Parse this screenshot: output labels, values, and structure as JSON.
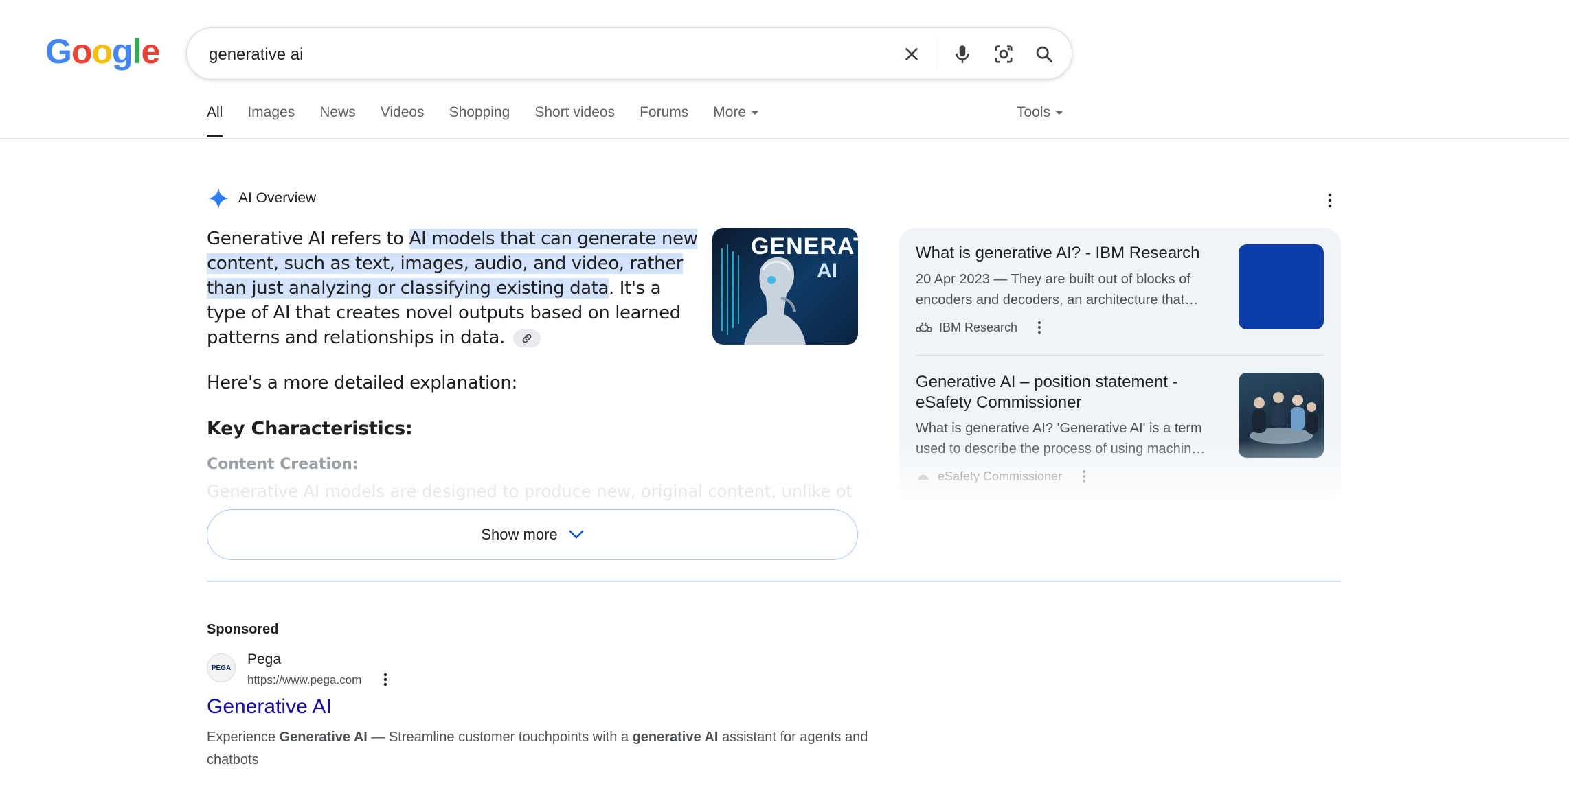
{
  "logo": {
    "text": [
      "G",
      "o",
      "o",
      "g",
      "l",
      "e"
    ]
  },
  "search": {
    "query": "generative ai"
  },
  "tabs": {
    "items": [
      "All",
      "Images",
      "News",
      "Videos",
      "Shopping",
      "Short videos",
      "Forums",
      "More"
    ],
    "tools": "Tools"
  },
  "ai_overview": {
    "label": "AI Overview",
    "p1_before": "Generative AI refers to ",
    "p1_highlight": "AI models that can generate new content, such as text, images, audio, and video, rather than just analyzing or classifying existing data",
    "p1_after": ". It's a type of AI that creates novel outputs based on learned patterns and relationships in data.",
    "image_text_1": "GENERAT",
    "image_text_2": "AI",
    "explain": "Here's a more detailed explanation:",
    "key_heading": "Key Characteristics:",
    "content_creation": "Content Creation:",
    "faded_line": "Generative AI models are designed to produce new, original content, unlike other AI",
    "show_more": "Show more"
  },
  "sources": [
    {
      "title": "What is generative AI? - IBM Research",
      "snippet_1": "20 Apr 2023 — They are built out of blocks of",
      "snippet_2": "encoders and decoders, an architecture that…",
      "site": "IBM Research",
      "thumb_color": "#0b3ca8"
    },
    {
      "title_1": "Generative AI – position statement -",
      "title_2": "eSafety Commissioner",
      "snippet_1": "What is generative AI? 'Generative AI' is a term",
      "snippet_2": "used to describe the process of using machin…",
      "site": "eSafety Commissioner"
    }
  ],
  "sponsored": {
    "label": "Sponsored",
    "advertiser": "Pega",
    "logo_text": "PEGA",
    "url": "https://www.pega.com",
    "title": "Generative AI",
    "desc_1": "Experience ",
    "desc_b1": "Generative AI",
    "desc_2": " — Streamline customer touchpoints with a ",
    "desc_b2": "generative AI",
    "desc_3": " assistant for agents and chatbots"
  }
}
